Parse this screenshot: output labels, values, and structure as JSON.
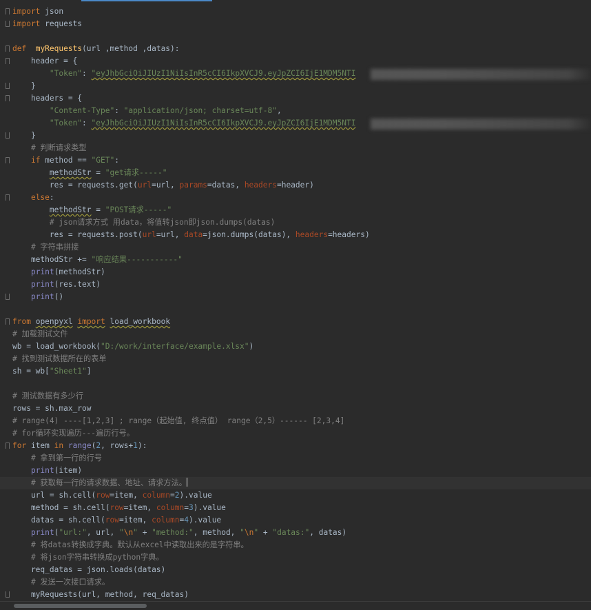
{
  "editor": {
    "token_value": "\"eyJhbGciOiJIUzI1NiIsInR5cCI6IkpXVCJ9.eyJpZCI6IjE1MDM5NTI",
    "lines": [
      [
        [
          "kw",
          "import"
        ],
        [
          "t",
          " json"
        ]
      ],
      [
        [
          "kw",
          "import"
        ],
        [
          "t",
          " requests"
        ]
      ],
      [
        [
          "t",
          ""
        ]
      ],
      [
        [
          "kw",
          "def "
        ],
        [
          "t",
          " "
        ],
        [
          "fn",
          "myRequests"
        ],
        [
          "t",
          "(url ,method ,datas):"
        ]
      ],
      [
        [
          "t",
          "    header = {"
        ]
      ],
      [
        [
          "t",
          "        "
        ],
        [
          "str",
          "\"Token\""
        ],
        [
          "t",
          ": "
        ],
        [
          "strsq",
          "\"eyJhbGciOiJIUzI1NiIsInR5cCI6IkpXVCJ9.eyJpZCI6IjE1MDM5NTI"
        ]
      ],
      [
        [
          "t",
          "    }"
        ]
      ],
      [
        [
          "t",
          "    headers = {"
        ]
      ],
      [
        [
          "t",
          "        "
        ],
        [
          "str",
          "\"Content-Type\""
        ],
        [
          "t",
          ": "
        ],
        [
          "str",
          "\"application/json; charset=utf-8\""
        ],
        [
          "t",
          ","
        ]
      ],
      [
        [
          "t",
          "        "
        ],
        [
          "str",
          "\"Token\""
        ],
        [
          "t",
          ": "
        ],
        [
          "strsq",
          "\"eyJhbGciOiJIUzI1NiIsInR5cCI6IkpXVCJ9.eyJpZCI6IjE1MDM5NTI"
        ]
      ],
      [
        [
          "t",
          "    }"
        ]
      ],
      [
        [
          "t",
          "    "
        ],
        [
          "com",
          "# 判断请求类型"
        ]
      ],
      [
        [
          "t",
          "    "
        ],
        [
          "kw",
          "if"
        ],
        [
          "t",
          " method == "
        ],
        [
          "str",
          "\"GET\""
        ],
        [
          "t",
          ":"
        ]
      ],
      [
        [
          "t",
          "        "
        ],
        [
          "sq",
          "methodStr"
        ],
        [
          "t",
          " = "
        ],
        [
          "str",
          "\"get请求-----\""
        ]
      ],
      [
        [
          "t",
          "        res = requests.get("
        ],
        [
          "param",
          "url"
        ],
        [
          "t",
          "=url, "
        ],
        [
          "param",
          "params"
        ],
        [
          "t",
          "=datas, "
        ],
        [
          "param",
          "headers"
        ],
        [
          "t",
          "=header)"
        ]
      ],
      [
        [
          "t",
          "    "
        ],
        [
          "kw",
          "else"
        ],
        [
          "t",
          ":"
        ]
      ],
      [
        [
          "t",
          "        "
        ],
        [
          "sq",
          "methodStr"
        ],
        [
          "t",
          " = "
        ],
        [
          "str",
          "\"POST请求-----\""
        ]
      ],
      [
        [
          "t",
          "        "
        ],
        [
          "com",
          "# json请求方式 用data，将值转json即json.dumps(datas)"
        ]
      ],
      [
        [
          "t",
          "        res = requests.post("
        ],
        [
          "param",
          "url"
        ],
        [
          "t",
          "=url, "
        ],
        [
          "param",
          "data"
        ],
        [
          "t",
          "=json.dumps(datas), "
        ],
        [
          "param",
          "headers"
        ],
        [
          "t",
          "=headers)"
        ]
      ],
      [
        [
          "t",
          "    "
        ],
        [
          "com",
          "# 字符串拼接"
        ]
      ],
      [
        [
          "t",
          "    methodStr += "
        ],
        [
          "str",
          "\"响应结果-----------\""
        ]
      ],
      [
        [
          "t",
          "    "
        ],
        [
          "bi",
          "print"
        ],
        [
          "t",
          "(methodStr)"
        ]
      ],
      [
        [
          "t",
          "    "
        ],
        [
          "bi",
          "print"
        ],
        [
          "t",
          "(res.text)"
        ]
      ],
      [
        [
          "t",
          "    "
        ],
        [
          "bi",
          "print"
        ],
        [
          "t",
          "()"
        ]
      ],
      [
        [
          "t",
          ""
        ]
      ],
      [
        [
          "kw",
          "from"
        ],
        [
          "t",
          " "
        ],
        [
          "sq",
          "openpyxl"
        ],
        [
          "t",
          " "
        ],
        [
          "kwsq",
          "import"
        ],
        [
          "t",
          " "
        ],
        [
          "sq",
          "load_workbook"
        ]
      ],
      [
        [
          "com",
          "# 加载测试文件"
        ]
      ],
      [
        [
          "t",
          "wb = load_workbook("
        ],
        [
          "str",
          "\"D:/work/interface/example.xlsx\""
        ],
        [
          "t",
          ")"
        ]
      ],
      [
        [
          "com",
          "# 找到测试数据所在的表单"
        ]
      ],
      [
        [
          "t",
          "sh = wb["
        ],
        [
          "str",
          "\"Sheet1\""
        ],
        [
          "t",
          "]"
        ]
      ],
      [
        [
          "t",
          ""
        ]
      ],
      [
        [
          "com",
          "# 测试数据有多少行"
        ]
      ],
      [
        [
          "t",
          "rows = sh.max_row"
        ]
      ],
      [
        [
          "com",
          "# range(4) ----[1,2,3] ; range（起始值, 终点值） range（2,5）------ [2,3,4]"
        ]
      ],
      [
        [
          "com",
          "# for循环实现遍历---遍历行号。"
        ]
      ],
      [
        [
          "kw",
          "for"
        ],
        [
          "t",
          " item "
        ],
        [
          "kw",
          "in"
        ],
        [
          "t",
          " "
        ],
        [
          "bi",
          "range"
        ],
        [
          "t",
          "("
        ],
        [
          "num",
          "2"
        ],
        [
          "t",
          ", rows+"
        ],
        [
          "num",
          "1"
        ],
        [
          "t",
          "):"
        ]
      ],
      [
        [
          "t",
          "    "
        ],
        [
          "com",
          "# 拿到第一行的行号"
        ]
      ],
      [
        [
          "t",
          "    "
        ],
        [
          "bi",
          "print"
        ],
        [
          "t",
          "(item)"
        ]
      ],
      [
        [
          "t",
          "    "
        ],
        [
          "com",
          "# 获取每一行的请求数据、地址、请求方法。"
        ],
        [
          "caret",
          ""
        ]
      ],
      [
        [
          "t",
          "    url = sh.cell("
        ],
        [
          "param",
          "row"
        ],
        [
          "t",
          "=item, "
        ],
        [
          "param",
          "column"
        ],
        [
          "t",
          "="
        ],
        [
          "num",
          "2"
        ],
        [
          "t",
          ").value"
        ]
      ],
      [
        [
          "t",
          "    method = sh.cell("
        ],
        [
          "param",
          "row"
        ],
        [
          "t",
          "=item, "
        ],
        [
          "param",
          "column"
        ],
        [
          "t",
          "="
        ],
        [
          "num",
          "3"
        ],
        [
          "t",
          ").value"
        ]
      ],
      [
        [
          "t",
          "    datas = sh.cell("
        ],
        [
          "param",
          "row"
        ],
        [
          "t",
          "=item, "
        ],
        [
          "param",
          "column"
        ],
        [
          "t",
          "="
        ],
        [
          "num",
          "4"
        ],
        [
          "t",
          ").value"
        ]
      ],
      [
        [
          "t",
          "    "
        ],
        [
          "bi",
          "print"
        ],
        [
          "t",
          "("
        ],
        [
          "str",
          "\"url:\""
        ],
        [
          "t",
          ", url, "
        ],
        [
          "str",
          "\""
        ],
        [
          "esc",
          "\\n"
        ],
        [
          "str",
          "\""
        ],
        [
          "t",
          " + "
        ],
        [
          "str",
          "\"method:\""
        ],
        [
          "t",
          ", method, "
        ],
        [
          "str",
          "\""
        ],
        [
          "esc",
          "\\n"
        ],
        [
          "str",
          "\""
        ],
        [
          "t",
          " + "
        ],
        [
          "str",
          "\"datas:\""
        ],
        [
          "t",
          ", datas)"
        ]
      ],
      [
        [
          "t",
          "    "
        ],
        [
          "com",
          "# 将datas转换成字典。默认从excel中读取出来的是字符串。"
        ]
      ],
      [
        [
          "t",
          "    "
        ],
        [
          "com",
          "# 将json字符串转换成python字典。"
        ]
      ],
      [
        [
          "t",
          "    req_datas = json.loads(datas)"
        ]
      ],
      [
        [
          "t",
          "    "
        ],
        [
          "com",
          "# 发送一次接口请求。"
        ]
      ],
      [
        [
          "t",
          "    myRequests(url, method, req_datas)"
        ]
      ]
    ]
  },
  "folds": {
    "start": [
      0,
      3,
      4,
      7,
      12,
      15,
      25,
      35
    ],
    "end": [
      1,
      6,
      10,
      23,
      47
    ]
  },
  "blurred_lines": [
    5,
    9
  ],
  "current_line": 38
}
